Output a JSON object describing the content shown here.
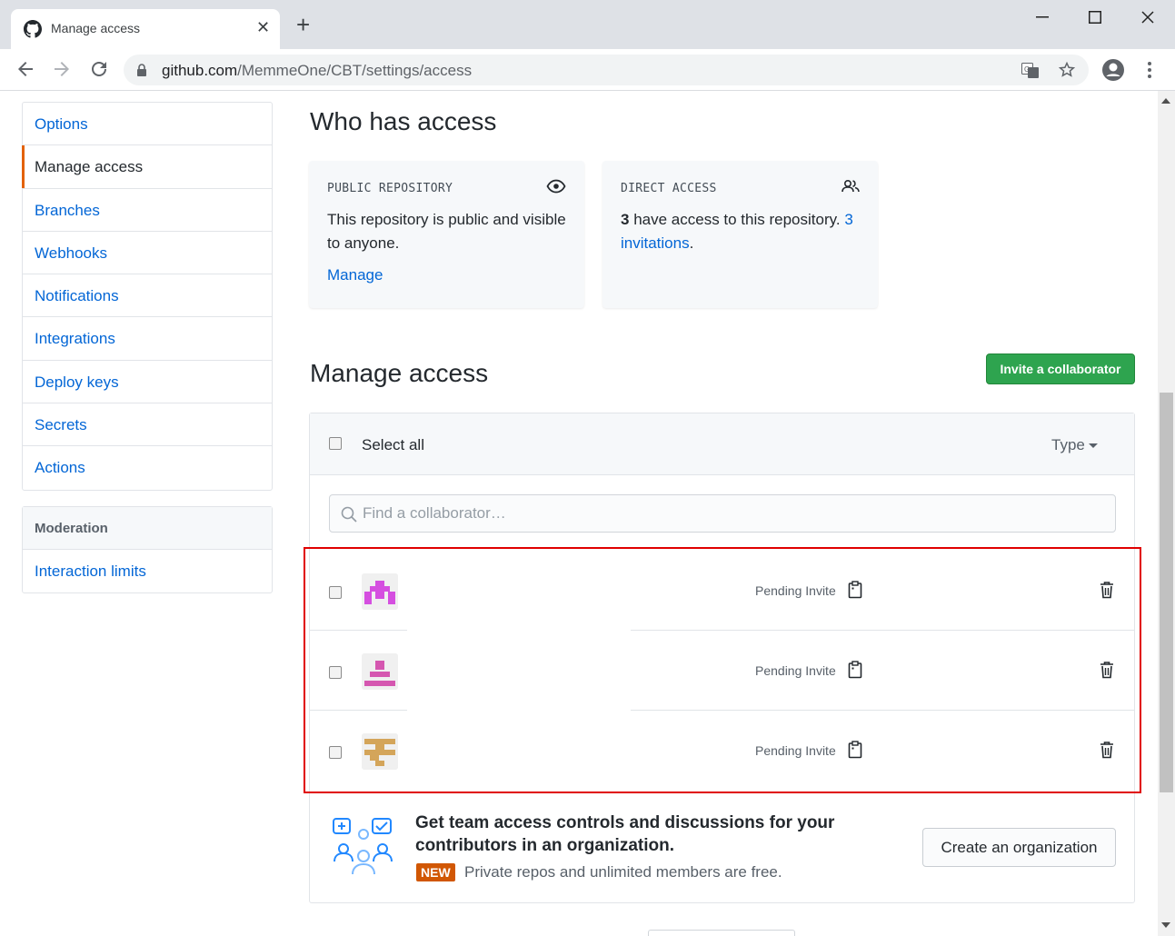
{
  "browser": {
    "tab_title": "Manage access",
    "url_host": "github.com",
    "url_path": "/MemmeOne/CBT/settings/access"
  },
  "sidebar": {
    "items": [
      {
        "label": "Options"
      },
      {
        "label": "Manage access"
      },
      {
        "label": "Branches"
      },
      {
        "label": "Webhooks"
      },
      {
        "label": "Notifications"
      },
      {
        "label": "Integrations"
      },
      {
        "label": "Deploy keys"
      },
      {
        "label": "Secrets"
      },
      {
        "label": "Actions"
      }
    ],
    "moderation_header": "Moderation",
    "moderation_items": [
      {
        "label": "Interaction limits"
      }
    ]
  },
  "who_has_access": {
    "title": "Who has access",
    "public_card": {
      "label": "PUBLIC REPOSITORY",
      "text": "This repository is public and visible to anyone.",
      "link": "Manage"
    },
    "direct_card": {
      "label": "DIRECT ACCESS",
      "count": "3",
      "text_mid": " have access to this repository. ",
      "invitations_link": "3 invitations",
      "end": "."
    }
  },
  "manage_access": {
    "title": "Manage access",
    "invite_button": "Invite a collaborator",
    "select_all": "Select all",
    "type_filter": "Type",
    "search_placeholder": "Find a collaborator…",
    "rows": [
      {
        "status": "Pending Invite"
      },
      {
        "status": "Pending Invite"
      },
      {
        "status": "Pending Invite"
      }
    ]
  },
  "promo": {
    "title": "Get team access controls and discussions for your contributors in an organization.",
    "badge": "NEW",
    "subtitle": "Private repos and unlimited members are free.",
    "button": "Create an organization"
  },
  "colors": {
    "accent_link": "#0366d6",
    "invite_green": "#2ea44f",
    "selected_bar": "#e36209",
    "highlight_red": "#e00000",
    "new_badge": "#d15704"
  }
}
